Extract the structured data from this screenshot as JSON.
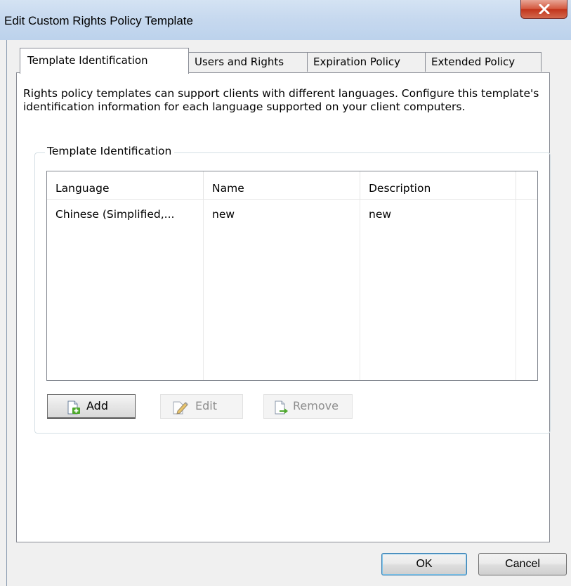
{
  "window": {
    "title": "Edit Custom Rights Policy Template",
    "close_icon": "close-x-icon"
  },
  "tabs": [
    {
      "label": "Template Identification",
      "active": true
    },
    {
      "label": "Users and Rights",
      "active": false
    },
    {
      "label": "Expiration Policy",
      "active": false
    },
    {
      "label": "Extended Policy",
      "active": false
    }
  ],
  "page": {
    "description": "Rights policy templates can support clients with different languages. Configure this template's identification information for each language supported on your client computers.",
    "group_label": "Template Identification"
  },
  "list": {
    "columns": [
      "Language",
      "Name",
      "Description"
    ],
    "rows": [
      {
        "language": "Chinese (Simplified,...",
        "name": "new",
        "description": "new"
      }
    ]
  },
  "actions": {
    "add": {
      "label": "Add",
      "enabled": true,
      "icon": "add-page-icon"
    },
    "edit": {
      "label": "Edit",
      "enabled": false,
      "icon": "edit-pencil-icon"
    },
    "remove": {
      "label": "Remove",
      "enabled": false,
      "icon": "remove-page-icon"
    }
  },
  "dialog_buttons": {
    "ok": "OK",
    "cancel": "Cancel"
  }
}
